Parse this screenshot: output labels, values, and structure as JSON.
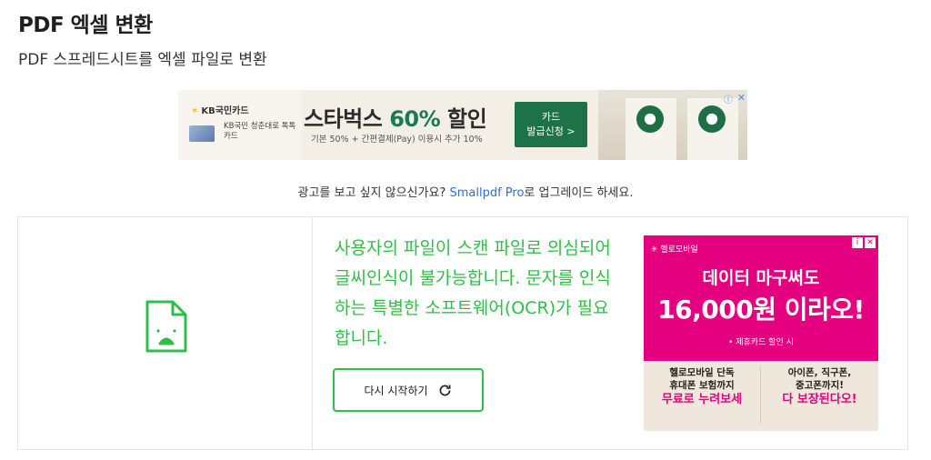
{
  "header": {
    "title": "PDF 엑셀 변환",
    "subtitle": "PDF 스프레드시트를 엑셀 파일로 변환"
  },
  "top_ad": {
    "brand": "KB국민카드",
    "card_name": "KB국민 청춘대로 톡톡카드",
    "headline_pre": "스타벅스 ",
    "headline_pct": "60%",
    "headline_post": " 할인",
    "sub": "기본 50% + 간편결제(Pay) 이용시 추가 10%",
    "cta_line1": "카드",
    "cta_line2": "발급신청 >",
    "close": "✕",
    "info": "ⓘ"
  },
  "upgrade": {
    "prefix": "광고를 보고 싶지 않으신가요? ",
    "link": "Smallpdf Pro",
    "suffix": "로 업그레이드 하세요."
  },
  "main": {
    "error_message": "사용자의 파일이 스캔 파일로 의심되어 글씨인식이 불가능합니다. 문자를 인식하는 특별한 소프트웨어(OCR)가 필요합니다.",
    "retry_label": "다시 시작하기",
    "accent_color": "#2fbf48"
  },
  "side_ad": {
    "brand": "헬로모바일",
    "headline1": "데이터 마구써도",
    "headline2": "16,000원 이라오!",
    "note": "• 제휴카드 할인 시",
    "col1_line1": "헬로모바일 단독",
    "col1_line2": "휴대폰 보험까지",
    "col1_emph": "무료로 누려보세",
    "col2_line1": "아이폰, 직구폰,",
    "col2_line2": "중고폰까지!",
    "col2_emph": "다 보장된다오!",
    "close": "✕",
    "info": "i",
    "color": "#e4007f"
  }
}
